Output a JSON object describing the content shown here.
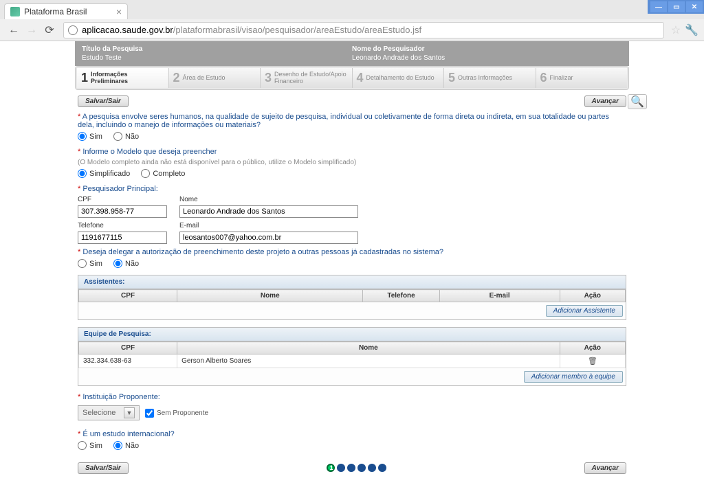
{
  "browser": {
    "tab_title": "Plataforma Brasil",
    "url_host": "aplicacao.saude.gov.br",
    "url_path": "/plataformabrasil/visao/pesquisador/areaEstudo/areaEstudo.jsf"
  },
  "header": {
    "titulo_label": "Título da Pesquisa",
    "titulo_value": "Estudo Teste",
    "pesquisador_label": "Nome do Pesquisador",
    "pesquisador_value": "Leonardo Andrade dos Santos"
  },
  "wizard": [
    {
      "num": "1",
      "label": "Informações Preliminares"
    },
    {
      "num": "2",
      "label": "Área de Estudo"
    },
    {
      "num": "3",
      "label": "Desenho de Estudo/Apoio Financeiro"
    },
    {
      "num": "4",
      "label": "Detalhamento do Estudo"
    },
    {
      "num": "5",
      "label": "Outras Informações"
    },
    {
      "num": "6",
      "label": "Finalizar"
    }
  ],
  "buttons": {
    "salvar_sair": "Salvar/Sair",
    "avancar": "Avançar",
    "add_assistente": "Adicionar Assistente",
    "add_membro": "Adicionar membro à equipe"
  },
  "q1": {
    "label": "A pesquisa envolve seres humanos, na qualidade de sujeito de pesquisa, individual ou coletivamente de forma direta ou indireta, em sua totalidade ou partes dela, incluindo o manejo de informações ou materiais?",
    "opt_sim": "Sim",
    "opt_nao": "Não"
  },
  "q2": {
    "label": "Informe o Modelo que deseja preencher",
    "hint": "(O Modelo completo ainda não está disponível para o público, utilize o Modelo simplificado)",
    "opt_simpl": "Simplificado",
    "opt_comp": "Completo"
  },
  "pesq_principal": {
    "label": "Pesquisador Principal:",
    "cpf_label": "CPF",
    "cpf_value": "307.398.958-77",
    "nome_label": "Nome",
    "nome_value": "Leonardo Andrade dos Santos",
    "tel_label": "Telefone",
    "tel_value": "1191677115",
    "email_label": "E-mail",
    "email_value": "leosantos007@yahoo.com.br"
  },
  "q_delegar": {
    "label": "Deseja delegar a autorização de preenchimento deste projeto a outras pessoas já cadastradas no sistema?",
    "opt_sim": "Sim",
    "opt_nao": "Não"
  },
  "assistentes": {
    "title": "Assistentes:",
    "cols": {
      "cpf": "CPF",
      "nome": "Nome",
      "tel": "Telefone",
      "email": "E-mail",
      "acao": "Ação"
    }
  },
  "equipe": {
    "title": "Equipe de Pesquisa:",
    "cols": {
      "cpf": "CPF",
      "nome": "Nome",
      "acao": "Ação"
    },
    "rows": [
      {
        "cpf": "332.334.638-63",
        "nome": "Gerson Alberto Soares"
      }
    ]
  },
  "inst": {
    "label": "Instituição Proponente:",
    "placeholder": "Selecione",
    "chk_label": "Sem Proponente"
  },
  "q_intl": {
    "label": "É um estudo internacional?",
    "opt_sim": "Sim",
    "opt_nao": "Não"
  },
  "pager_current": "1"
}
